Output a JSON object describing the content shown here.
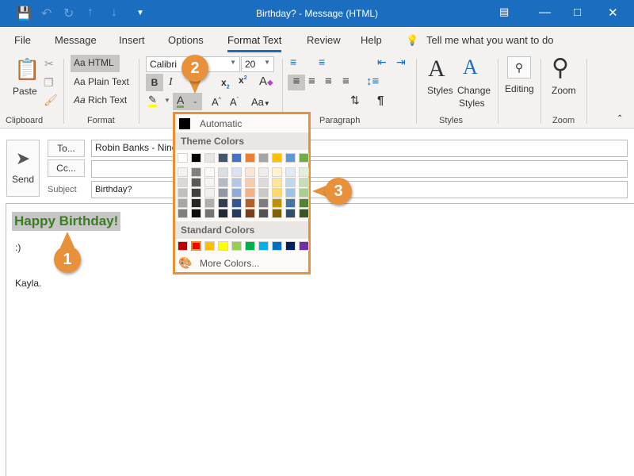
{
  "window": {
    "title": "Birthday? - Message (HTML)"
  },
  "quick_access": [
    "save-icon",
    "undo-icon",
    "redo-icon",
    "up-icon",
    "down-icon",
    "customize-icon"
  ],
  "tabs": [
    "File",
    "Message",
    "Insert",
    "Options",
    "Format Text",
    "Review",
    "Help"
  ],
  "active_tab": "Format Text",
  "tell_me": "Tell me what you want to do",
  "ribbon": {
    "clipboard": {
      "label": "Clipboard",
      "paste": "Paste"
    },
    "format": {
      "label": "Format",
      "html": "HTML",
      "plain": "Plain Text",
      "rich": "Rich Text",
      "aa": "Aa"
    },
    "font": {
      "name": "Calibri",
      "size": "20",
      "change_case": "Aa"
    },
    "paragraph": {
      "label": "Paragraph"
    },
    "styles": {
      "label": "Styles",
      "styles": "Styles",
      "change": "Change",
      "change2": "Styles"
    },
    "editing": {
      "label": "Editing"
    },
    "zoom": {
      "label": "Zoom",
      "zoom": "Zoom"
    }
  },
  "compose": {
    "send": "Send",
    "to_button": "To...",
    "cc_button": "Cc...",
    "subject_label": "Subject",
    "to_value": "Robin Banks - Ninco",
    "cc_value": "",
    "subject_value": "Birthday?"
  },
  "body": {
    "heading": "Happy Birthday!",
    "line1": ":)",
    "signature": "Kayla."
  },
  "font_color_menu": {
    "automatic": "Automatic",
    "theme_header": "Theme Colors",
    "theme_colors": [
      "#FFFFFF",
      "#000000",
      "#E7E6E6",
      "#44546A",
      "#4472C4",
      "#ED7D31",
      "#A5A5A5",
      "#FFC000",
      "#5B9BD5",
      "#70AD47"
    ],
    "standard_header": "Standard Colors",
    "standard_colors": [
      "#C00000",
      "#FF0000",
      "#FFC000",
      "#FFFF00",
      "#92D050",
      "#00B050",
      "#00B0F0",
      "#0070C0",
      "#002060",
      "#7030A0"
    ],
    "selected_standard": "#FF0000",
    "more": "More Colors..."
  },
  "callouts": [
    "1",
    "2",
    "3"
  ],
  "colors": {
    "accent": "#1a6dbf",
    "callout": "#e8913a",
    "heading_text": "#3a7d22",
    "highlight": "#c6c6c6",
    "font_color_bar": "#70AD47",
    "highlighter_bar": "#FFFF00"
  }
}
